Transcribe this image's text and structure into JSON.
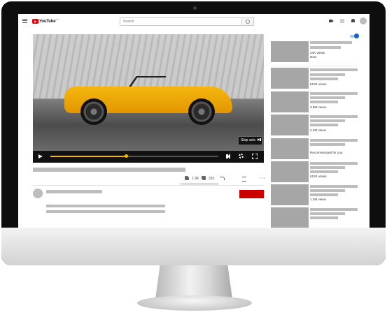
{
  "header": {
    "logo_text": "YouTube",
    "logo_region": "CH",
    "search_placeholder": "Search"
  },
  "player": {
    "skip_ad_label": "Skip ads",
    "progress_fraction": 0.45
  },
  "video_actions": {
    "likes": "1.9K",
    "dislikes": "315"
  },
  "sidebar": {
    "videos": [
      {
        "meta": "24K views",
        "meta2": "New"
      },
      {
        "meta": "513K views"
      },
      {
        "meta": "3.5M views"
      },
      {
        "meta": "2.2M views"
      },
      {
        "meta": "Recommended for you"
      },
      {
        "meta": "612K views"
      },
      {
        "meta": "1.2M views"
      }
    ]
  },
  "colors": {
    "brand_red": "#e00000",
    "subscribe_red": "#cc0000",
    "progress": "#f5b800",
    "toggle_blue": "#1565c0"
  }
}
